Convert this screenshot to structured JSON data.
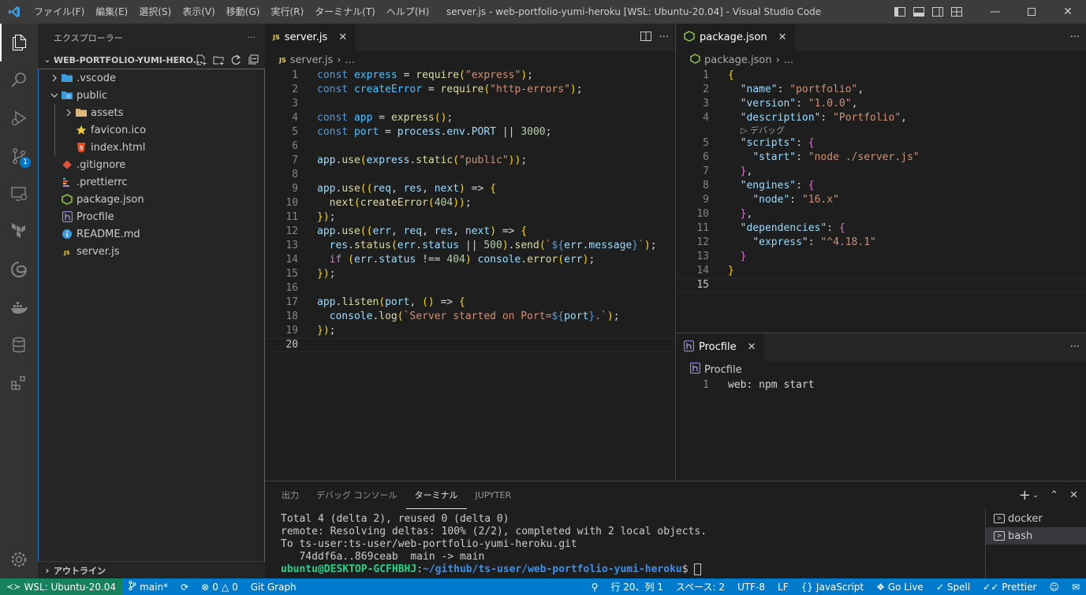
{
  "window": {
    "title": "server.js - web-portfolio-yumi-heroku [WSL: Ubuntu-20.04] - Visual Studio Code",
    "menu": [
      "ファイル(F)",
      "編集(E)",
      "選択(S)",
      "表示(V)",
      "移動(G)",
      "実行(R)",
      "ターミナル(T)",
      "ヘルプ(H)"
    ]
  },
  "activity_bar": {
    "items": [
      "files-icon",
      "search-icon",
      "run-debug-icon",
      "source-control-icon",
      "remote-explorer-icon",
      "terraform-icon",
      "edge-icon",
      "docker-icon",
      "database-icon",
      "extensions-icon"
    ],
    "source_control_badge": "1"
  },
  "sidebar": {
    "header": "エクスプローラー",
    "more": "···",
    "section": "WEB-PORTFOLIO-YUMI-HERO...",
    "outline": "アウトライン",
    "tree": [
      {
        "name": ".vscode",
        "type": "folder",
        "depth": 0,
        "expanded": false
      },
      {
        "name": "public",
        "type": "folder",
        "depth": 0,
        "expanded": true
      },
      {
        "name": "assets",
        "type": "folder",
        "depth": 1,
        "expanded": false
      },
      {
        "name": "favicon.ico",
        "type": "favicon",
        "depth": 1
      },
      {
        "name": "index.html",
        "type": "html",
        "depth": 1
      },
      {
        "name": ".gitignore",
        "type": "git",
        "depth": 0
      },
      {
        "name": ".prettierrc",
        "type": "prettier",
        "depth": 0
      },
      {
        "name": "package.json",
        "type": "npm",
        "depth": 0
      },
      {
        "name": "Procfile",
        "type": "heroku",
        "depth": 0
      },
      {
        "name": "README.md",
        "type": "info",
        "depth": 0
      },
      {
        "name": "server.js",
        "type": "js",
        "depth": 0
      }
    ]
  },
  "editor_left": {
    "tab": "server.js",
    "breadcrumb": [
      "server.js",
      "..."
    ],
    "current_line": 20,
    "lines": [
      "const express = require(\"express\");",
      "const createError = require(\"http-errors\");",
      "",
      "const app = express();",
      "const port = process.env.PORT || 3000;",
      "",
      "app.use(express.static(\"public\"));",
      "",
      "app.use((req, res, next) => {",
      "  next(createError(404));",
      "});",
      "app.use((err, req, res, next) => {",
      "  res.status(err.status || 500).send(`${err.message}`);",
      "  if (err.status !== 404) console.error(err);",
      "});",
      "",
      "app.listen(port, () => {",
      "  console.log(`Server started on Port=${port}.`);",
      "});",
      ""
    ]
  },
  "editor_right_top": {
    "tab": "package.json",
    "breadcrumb": [
      "package.json",
      "..."
    ],
    "codelens": "▷ デバッグ",
    "current_line": 15,
    "lines": [
      "{",
      "  \"name\": \"portfolio\",",
      "  \"version\": \"1.0.0\",",
      "  \"description\": \"Portfolio\",",
      "  \"scripts\": {",
      "    \"start\": \"node ./server.js\"",
      "  },",
      "  \"engines\": {",
      "    \"node\": \"16.x\"",
      "  },",
      "  \"dependencies\": {",
      "    \"express\": \"^4.18.1\"",
      "  }",
      "}",
      ""
    ]
  },
  "editor_right_bottom": {
    "tab": "Procfile",
    "breadcrumb": [
      "Procfile"
    ],
    "lines": [
      "web: npm start"
    ]
  },
  "panel": {
    "tabs": [
      "出力",
      "デバッグ コンソール",
      "ターミナル",
      "JUPYTER"
    ],
    "active_tab": "ターミナル",
    "terminal_lines": [
      "Total 4 (delta 2), reused 0 (delta 0)",
      "remote: Resolving deltas: 100% (2/2), completed with 2 local objects.",
      "To ts-user:ts-user/web-portfolio-yumi-heroku.git",
      "   74ddf6a..869ceab  main -> main"
    ],
    "prompt_user": "ubuntu@DESKTOP-GCFHBHJ",
    "prompt_sep": ":",
    "prompt_path": "~/github/ts-user/web-portfolio-yumi-heroku",
    "prompt_end": "$ ",
    "terminals": [
      "docker",
      "bash"
    ],
    "active_terminal": "bash"
  },
  "statusbar": {
    "remote": "WSL: Ubuntu-20.04",
    "branch": "main*",
    "problems": "0",
    "warnings": "0",
    "git_graph": "Git Graph",
    "position": "行 20、列 1",
    "spaces": "スペース: 2",
    "encoding": "UTF-8",
    "eol": "LF",
    "language": "JavaScript",
    "go_live": "Go Live",
    "spell": "Spell",
    "prettier": "Prettier"
  },
  "colors": {
    "accent": "#007acc",
    "remote": "#16825d",
    "focus_border": "#007fd4"
  }
}
